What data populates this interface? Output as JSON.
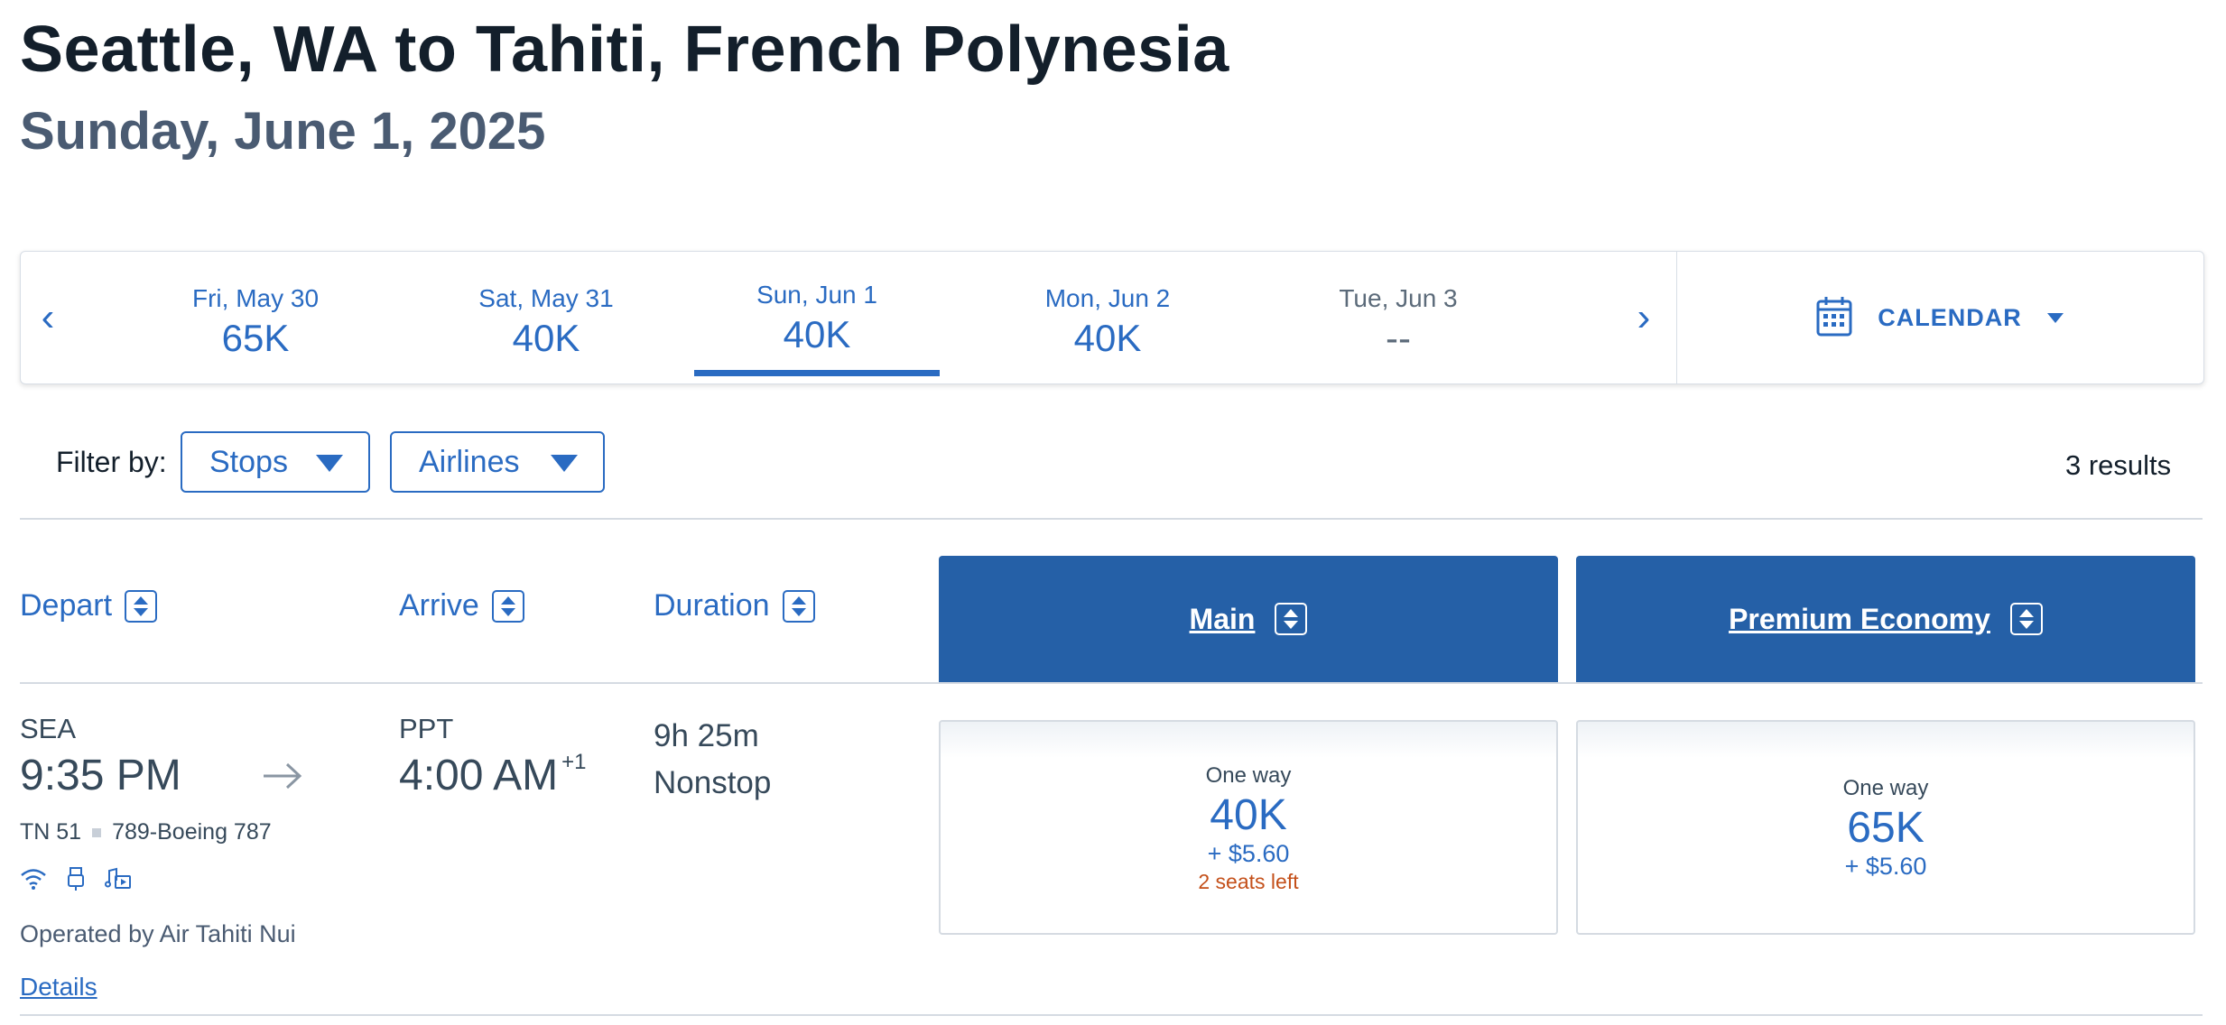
{
  "header": {
    "title": "Seattle, WA to Tahiti, French Polynesia",
    "date": "Sunday, June 1, 2025"
  },
  "date_strip": {
    "prev_arrow": "‹",
    "next_arrow": "›",
    "days": [
      {
        "label": "Fri, May 30",
        "price": "65K",
        "selected": false
      },
      {
        "label": "Sat, May 31",
        "price": "40K",
        "selected": false
      },
      {
        "label": "Sun, Jun 1",
        "price": "40K",
        "selected": true
      },
      {
        "label": "Mon, Jun 2",
        "price": "40K",
        "selected": false
      },
      {
        "label": "Tue, Jun 3",
        "price": "--",
        "selected": false
      }
    ],
    "calendar_label": "CALENDAR"
  },
  "filters": {
    "label": "Filter by:",
    "stops": "Stops",
    "airlines": "Airlines",
    "results": "3 results"
  },
  "columns": {
    "depart": "Depart",
    "arrive": "Arrive",
    "duration": "Duration",
    "main": "Main",
    "premium": "Premium Economy"
  },
  "flight": {
    "origin": "SEA",
    "depart_time": "9:35 PM",
    "destination": "PPT",
    "arrive_time": "4:00 AM",
    "day_offset": "+1",
    "duration": "9h 25m",
    "stops": "Nonstop",
    "flight_number": "TN 51",
    "aircraft": "789-Boeing 787",
    "operated_by": "Operated by Air Tahiti Nui",
    "details": "Details",
    "amenities": [
      "wifi-icon",
      "usb-power-icon",
      "entertainment-icon"
    ],
    "fares": {
      "main": {
        "label": "One way",
        "points": "40K",
        "tax": "+ $5.60",
        "seats": "2 seats left"
      },
      "premium": {
        "label": "One way",
        "points": "65K",
        "tax": "+ $5.60"
      }
    }
  },
  "colors": {
    "accent": "#2a6bc2",
    "cabin_header": "#2560a7",
    "warning": "#c4501a",
    "title": "#131f2b"
  }
}
